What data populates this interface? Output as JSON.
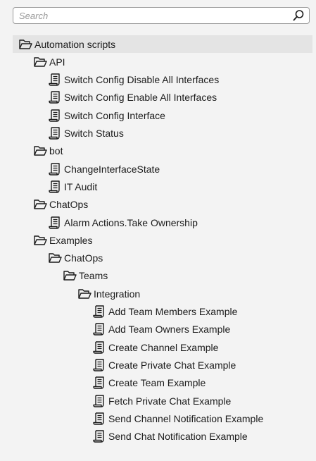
{
  "search": {
    "placeholder": "Search",
    "value": "",
    "icon": "search-icon"
  },
  "tree": [
    {
      "label": "Automation scripts",
      "type": "folder",
      "depth": 0,
      "selected": true
    },
    {
      "label": "API",
      "type": "folder",
      "depth": 1
    },
    {
      "label": "Switch Config Disable All Interfaces",
      "type": "script",
      "depth": 2
    },
    {
      "label": "Switch Config Enable All Interfaces",
      "type": "script",
      "depth": 2
    },
    {
      "label": "Switch Config Interface",
      "type": "script",
      "depth": 2
    },
    {
      "label": "Switch Status",
      "type": "script",
      "depth": 2
    },
    {
      "label": "bot",
      "type": "folder",
      "depth": 1
    },
    {
      "label": "ChangeInterfaceState",
      "type": "script",
      "depth": 2
    },
    {
      "label": "IT Audit",
      "type": "script",
      "depth": 2
    },
    {
      "label": "ChatOps",
      "type": "folder",
      "depth": 1
    },
    {
      "label": "Alarm Actions.Take Ownership",
      "type": "script",
      "depth": 2
    },
    {
      "label": "Examples",
      "type": "folder",
      "depth": 1
    },
    {
      "label": "ChatOps",
      "type": "folder",
      "depth": 2
    },
    {
      "label": "Teams",
      "type": "folder",
      "depth": 3
    },
    {
      "label": "Integration",
      "type": "folder",
      "depth": 4
    },
    {
      "label": "Add Team Members Example",
      "type": "script",
      "depth": 5
    },
    {
      "label": "Add Team Owners Example",
      "type": "script",
      "depth": 5
    },
    {
      "label": "Create Channel Example",
      "type": "script",
      "depth": 5
    },
    {
      "label": "Create Private Chat Example",
      "type": "script",
      "depth": 5
    },
    {
      "label": "Create Team Example",
      "type": "script",
      "depth": 5
    },
    {
      "label": "Fetch Private Chat Example",
      "type": "script",
      "depth": 5
    },
    {
      "label": "Send Channel Notification Example",
      "type": "script",
      "depth": 5
    },
    {
      "label": "Send Chat Notification Example",
      "type": "script",
      "depth": 5
    }
  ],
  "icons": {
    "folder": "folder-open-icon",
    "script": "script-icon"
  },
  "colors": {
    "background": "#f3f3f3",
    "selected_row": "#e4e4e4",
    "text": "#1b1b1b",
    "search_border": "#9a9a9a"
  }
}
